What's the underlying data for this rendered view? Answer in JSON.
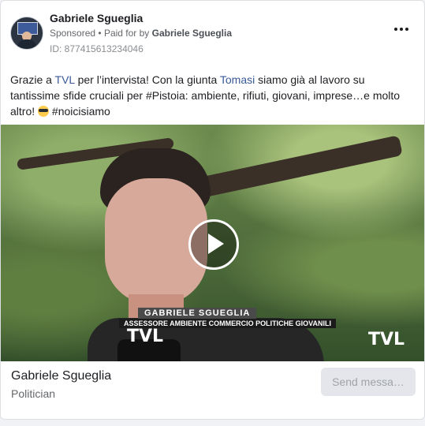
{
  "post": {
    "author": "Gabriele Sgueglia",
    "sponsored_label": "Sponsored",
    "paid_for_prefix": "Paid for by",
    "paid_for_by": "Gabriele Sgueglia",
    "id_line": "ID: 877415613234046",
    "text": {
      "p1": "Grazie a ",
      "link1": "TVL",
      "p2": " per l’intervista! Con la giunta ",
      "link2": "Tomasi",
      "p3": " siamo già al lavoro su tantissime sfide cruciali per #Pistoia: ambiente, rifiuti, giovani, imprese…e molto altro! ",
      "p4": " #noicisiamo"
    },
    "video_overlay": {
      "name_bar": "GABRIELE SGUEGLIA",
      "role_bar": "ASSESSORE AMBIENTE COMMERCIO POLITICHE GIOVANILI",
      "brand": "TVL",
      "brand_on_mic": "TVL"
    }
  },
  "footer": {
    "page_name": "Gabriele Sgueglia",
    "category": "Politician",
    "cta_label": "Send messa…"
  },
  "icons": {
    "more": "more-horizontal-icon",
    "play": "play-icon",
    "emoji": "sunglasses-emoji-icon"
  },
  "colors": {
    "link": "#385898",
    "cta_bg": "#e4e6eb",
    "border": "#dddfe2"
  }
}
